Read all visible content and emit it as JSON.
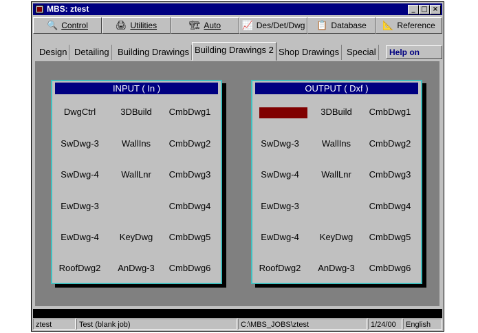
{
  "window": {
    "title": "MBS: ztest",
    "minimize": "_",
    "maximize": "□",
    "close": "×"
  },
  "toolbar": [
    {
      "label": "Control",
      "icon": "🔍"
    },
    {
      "label": "Utilities",
      "icon": "🖨"
    },
    {
      "label": "Auto",
      "icon": "🏗"
    },
    {
      "label": "Des/Det/Dwg",
      "icon": "📈"
    },
    {
      "label": "Database",
      "icon": "📋"
    },
    {
      "label": "Reference",
      "icon": "📐"
    }
  ],
  "tabs": [
    "Design",
    "Detailing",
    "Building Drawings",
    "Building Drawings 2",
    "Shop Drawings",
    "Special"
  ],
  "active_tab": "Building Drawings 2",
  "help_button": "Help on MBS",
  "input_panel": {
    "title": "INPUT ( In )",
    "rows": [
      [
        "DwgCtrl",
        "3DBuild",
        "CmbDwg1"
      ],
      [
        "SwDwg-3",
        "WallIns",
        "CmbDwg2"
      ],
      [
        "SwDwg-4",
        "WallLnr",
        "CmbDwg3"
      ],
      [
        "EwDwg-3",
        "",
        "CmbDwg4"
      ],
      [
        "EwDwg-4",
        "KeyDwg",
        "CmbDwg5"
      ],
      [
        "RoofDwg2",
        "AnDwg-3",
        "CmbDwg6"
      ]
    ]
  },
  "output_panel": {
    "title": "OUTPUT ( Dxf )",
    "rows": [
      [
        "",
        "3DBuild",
        "CmbDwg1"
      ],
      [
        "SwDwg-3",
        "WallIns",
        "CmbDwg2"
      ],
      [
        "SwDwg-4",
        "WallLnr",
        "CmbDwg3"
      ],
      [
        "EwDwg-3",
        "",
        "CmbDwg4"
      ],
      [
        "EwDwg-4",
        "KeyDwg",
        "CmbDwg5"
      ],
      [
        "RoofDwg2",
        "AnDwg-3",
        "CmbDwg6"
      ]
    ],
    "highlight_color": "#800000"
  },
  "status": {
    "job": "ztest",
    "description": "Test (blank job)",
    "path": "C:\\MBS_JOBS\\ztest",
    "date": "1/24/00",
    "language": "English"
  }
}
